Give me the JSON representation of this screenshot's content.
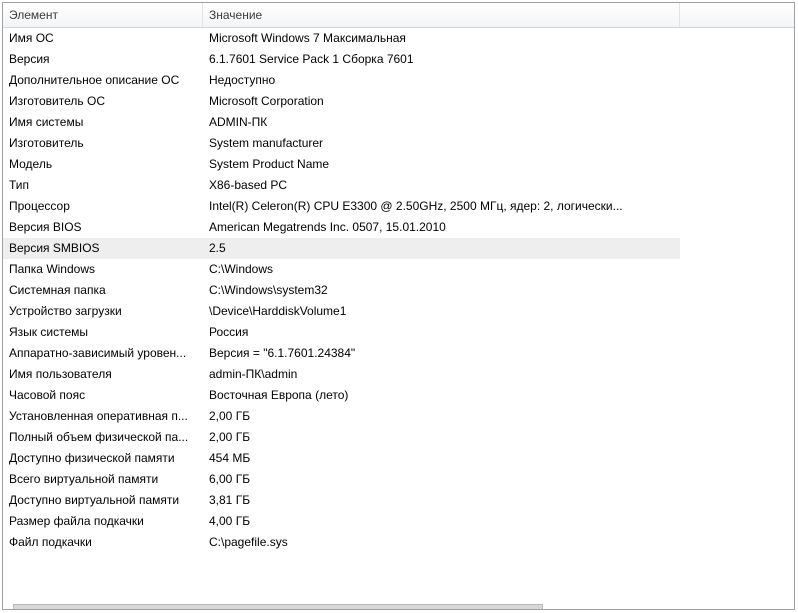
{
  "header": {
    "col_element": "Элемент",
    "col_value": "Значение"
  },
  "rows": [
    {
      "element": "Имя ОС",
      "value": "Microsoft Windows 7 Максимальная"
    },
    {
      "element": "Версия",
      "value": "6.1.7601 Service Pack 1 Сборка 7601"
    },
    {
      "element": "Дополнительное описание ОС",
      "value": "Недоступно"
    },
    {
      "element": "Изготовитель ОС",
      "value": "Microsoft Corporation"
    },
    {
      "element": "Имя системы",
      "value": "ADMIN-ПК"
    },
    {
      "element": "Изготовитель",
      "value": "System manufacturer"
    },
    {
      "element": "Модель",
      "value": "System Product Name"
    },
    {
      "element": "Тип",
      "value": "X86-based PC"
    },
    {
      "element": "Процессор",
      "value": "Intel(R) Celeron(R) CPU        E3300  @ 2.50GHz, 2500 МГц, ядер: 2, логически..."
    },
    {
      "element": "Версия BIOS",
      "value": "American Megatrends Inc. 0507, 15.01.2010"
    },
    {
      "element": "Версия SMBIOS",
      "value": "2.5"
    },
    {
      "element": "Папка Windows",
      "value": "C:\\Windows"
    },
    {
      "element": "Системная папка",
      "value": "C:\\Windows\\system32"
    },
    {
      "element": "Устройство загрузки",
      "value": "\\Device\\HarddiskVolume1"
    },
    {
      "element": "Язык системы",
      "value": "Россия"
    },
    {
      "element": "Аппаратно-зависимый уровен...",
      "value": "Версия = \"6.1.7601.24384\""
    },
    {
      "element": "Имя пользователя",
      "value": "admin-ПК\\admin"
    },
    {
      "element": "Часовой пояс",
      "value": "Восточная Европа (лето)"
    },
    {
      "element": "Установленная оперативная п...",
      "value": "2,00 ГБ"
    },
    {
      "element": "Полный объем физической па...",
      "value": "2,00 ГБ"
    },
    {
      "element": "Доступно физической памяти",
      "value": "454 МБ"
    },
    {
      "element": "Всего виртуальной памяти",
      "value": "6,00 ГБ"
    },
    {
      "element": "Доступно виртуальной памяти",
      "value": "3,81 ГБ"
    },
    {
      "element": "Размер файла подкачки",
      "value": "4,00 ГБ"
    },
    {
      "element": "Файл подкачки",
      "value": "C:\\pagefile.sys"
    }
  ],
  "selected_row_index": 10
}
